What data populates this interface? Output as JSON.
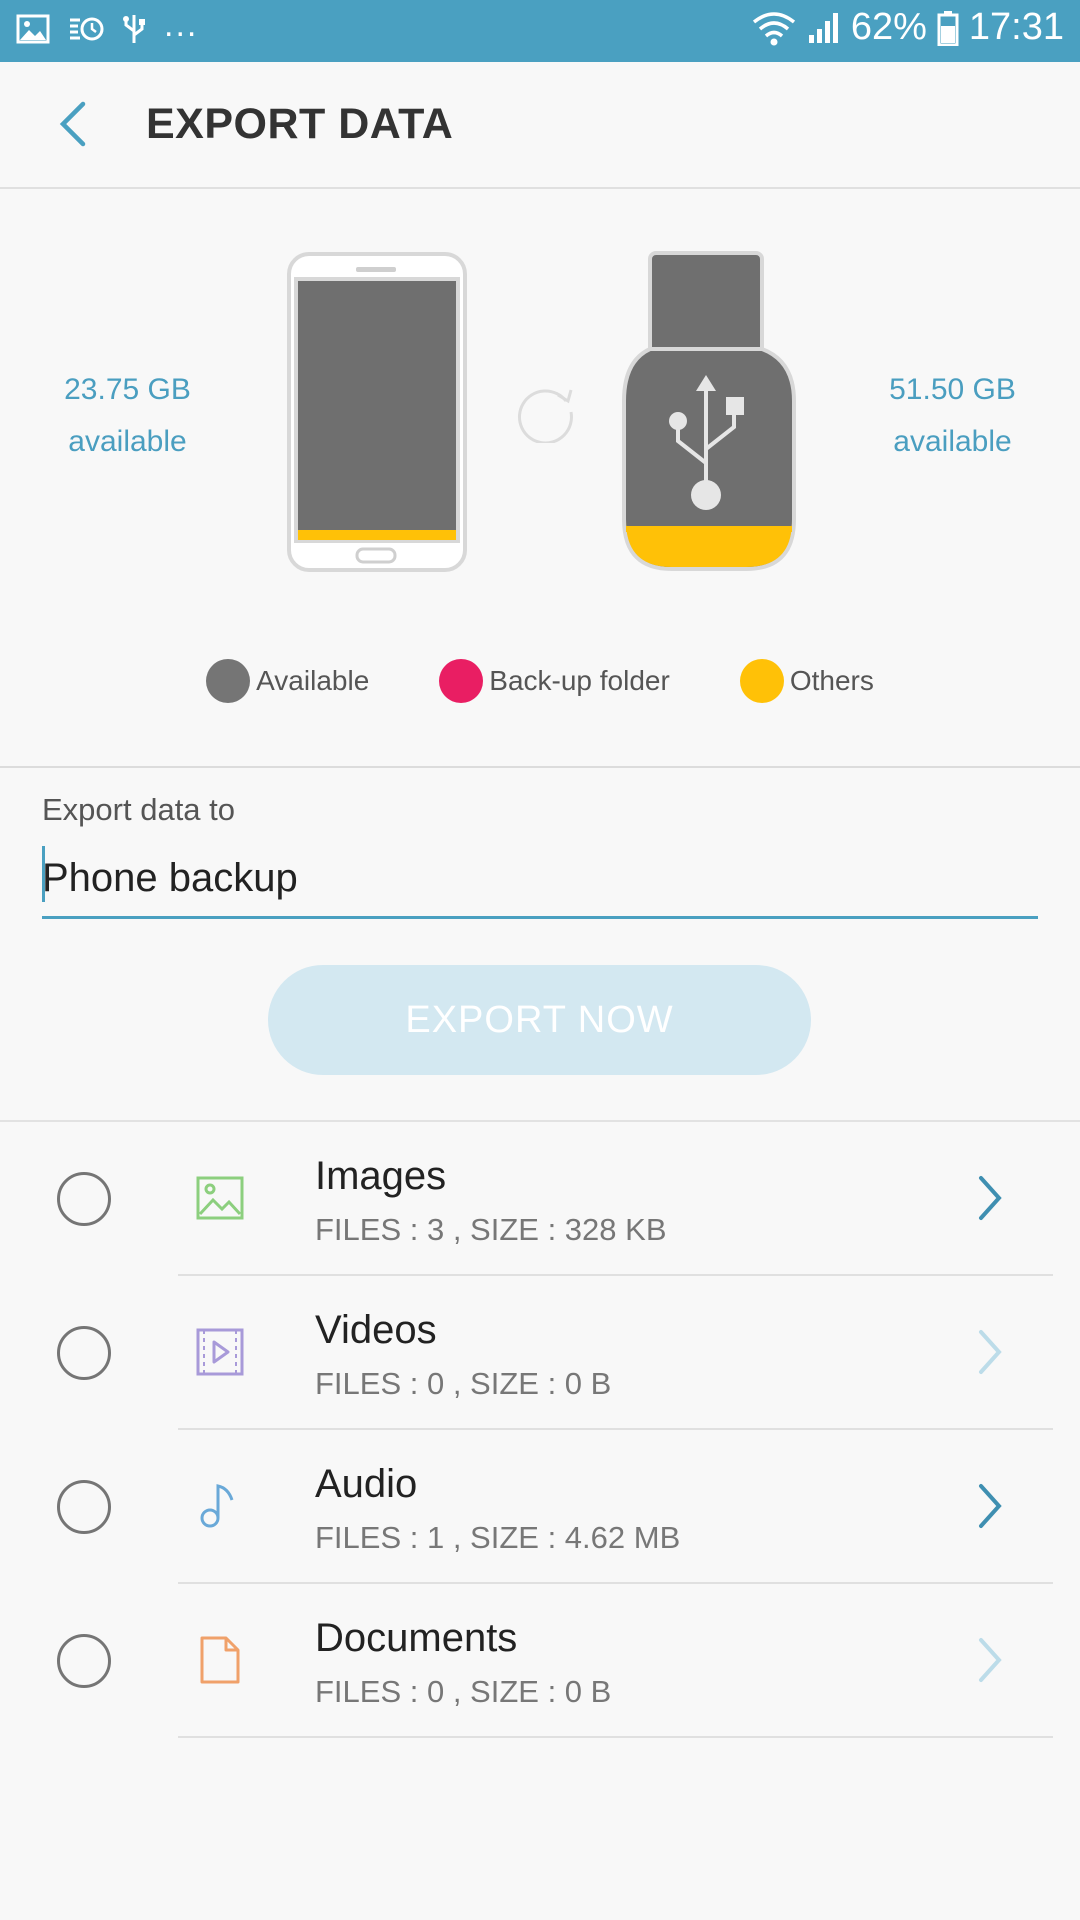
{
  "status_bar": {
    "dots": "...",
    "battery": "62%",
    "time": "17:31"
  },
  "header": {
    "title": "EXPORT DATA"
  },
  "storage": {
    "phone_available_line1": "23.75 GB",
    "phone_available_line2": "available",
    "usb_available_line1": "51.50 GB",
    "usb_available_line2": "available",
    "colors": {
      "available": "#757575",
      "backup": "#e91e63",
      "others": "#ffc107"
    },
    "legend": [
      {
        "label": "Available",
        "color": "#757575"
      },
      {
        "label": "Back-up folder",
        "color": "#e91e63"
      },
      {
        "label": "Others",
        "color": "#ffc107"
      }
    ]
  },
  "export": {
    "label": "Export data to",
    "value": "Phone backup",
    "button": "EXPORT NOW"
  },
  "categories": [
    {
      "name": "Images",
      "info": "FILES : 3 , SIZE : 328 KB",
      "icon": "image-icon",
      "icon_color": "#8ccf7e",
      "chevron_color": "#3f8fb1"
    },
    {
      "name": "Videos",
      "info": "FILES : 0 , SIZE : 0 B",
      "icon": "video-icon",
      "icon_color": "#a89ad9",
      "chevron_color": "#bcdce9"
    },
    {
      "name": "Audio",
      "info": "FILES : 1 , SIZE : 4.62 MB",
      "icon": "music-note-icon",
      "icon_color": "#6aa9d8",
      "chevron_color": "#3f8fb1"
    },
    {
      "name": "Documents",
      "info": "FILES : 0 , SIZE : 0 B",
      "icon": "document-icon",
      "icon_color": "#f0a16a",
      "chevron_color": "#bcdce9"
    }
  ]
}
